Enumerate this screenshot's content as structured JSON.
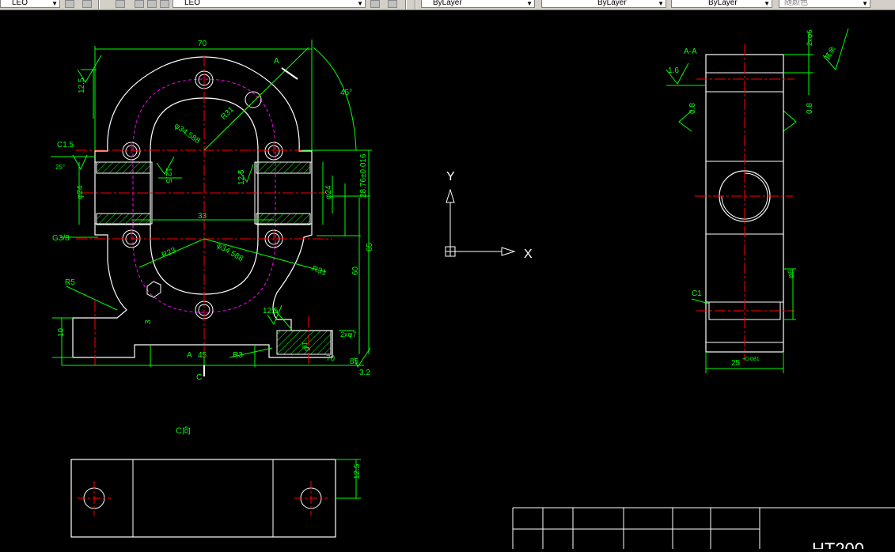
{
  "toolbar": {
    "layer_value": "LEO",
    "color_value": "ByLayer",
    "linetype_value": "ByLayer",
    "lineweight_value": "ByLayer",
    "plotstyle_value": "随颜色"
  },
  "drawing": {
    "main_view": {
      "dim_top_width": "70",
      "dim_left_height": "12.5",
      "label_section": "A",
      "dim_angle": "45°",
      "dim_bolt_circle": "φ34.588",
      "dim_r31_top": "R31",
      "label_chamfer": "C1.5",
      "label_angle_25": "25°",
      "dim_bore_left": "φ24",
      "dim_bore_right": "φ24",
      "roughness_top": "12.5",
      "roughness_mid": "12.5",
      "dim_center_spacing": "33",
      "dim_height_tol": "28.76±0.016",
      "dim_height_65": "65",
      "dim_height_60": "60",
      "label_thread": "G3/8",
      "dim_r23": "R23",
      "dim_bolt_circle_2": "φ34.588",
      "dim_r31_bottom": "R31",
      "dim_r5": "R5",
      "roughness_base": "12.5",
      "dim_base_10": "10",
      "dim_3": "3",
      "dim_slot": "2xφ7",
      "dim_9": "9",
      "dim_16": "16",
      "label_a_bottom": "A",
      "dim_45": "45",
      "dim_r3": "R3",
      "dim_70_bottom": "70",
      "dim_85": "85",
      "roughness_bottom": "3.2",
      "label_c": "C"
    },
    "section_view": {
      "label_section": "A-A",
      "roughness_top": "1.6",
      "label_2xphi6": "2xφ6",
      "label_rest": "其余",
      "roughness_left": "0.8",
      "roughness_right": "0.8",
      "dim_side": "φ6",
      "label_chamfer": "C1",
      "dim_width": "25",
      "dim_width_tol": "+0.081"
    },
    "ucs": {
      "y_label": "Y",
      "x_label": "X"
    },
    "bottom_view": {
      "title": "C向",
      "dim_height": "12.5"
    },
    "title_block": {
      "material": "HT200"
    }
  }
}
